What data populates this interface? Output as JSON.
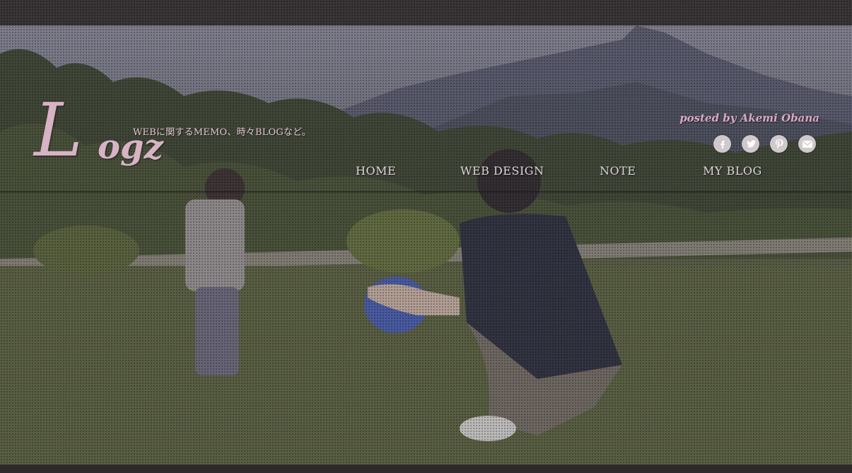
{
  "site": {
    "logo": {
      "initial": "L",
      "rest": "ogz"
    },
    "tagline": "WEBに関するMEMO、時々BLOGなど。",
    "posted_by": "posted by Akemi Obana"
  },
  "social": [
    {
      "name": "facebook",
      "icon": "facebook-icon"
    },
    {
      "name": "twitter",
      "icon": "twitter-icon"
    },
    {
      "name": "pinterest",
      "icon": "pinterest-icon"
    },
    {
      "name": "mail",
      "icon": "mail-icon"
    }
  ],
  "nav": [
    {
      "label": "HOME"
    },
    {
      "label": "WEB DESIGN"
    },
    {
      "label": "NOTE"
    },
    {
      "label": "MY BLOG"
    }
  ],
  "colors": {
    "accent_pink": "#d9a8c4",
    "background": "#2e2a2b",
    "nav_text": "#ddd6da"
  }
}
